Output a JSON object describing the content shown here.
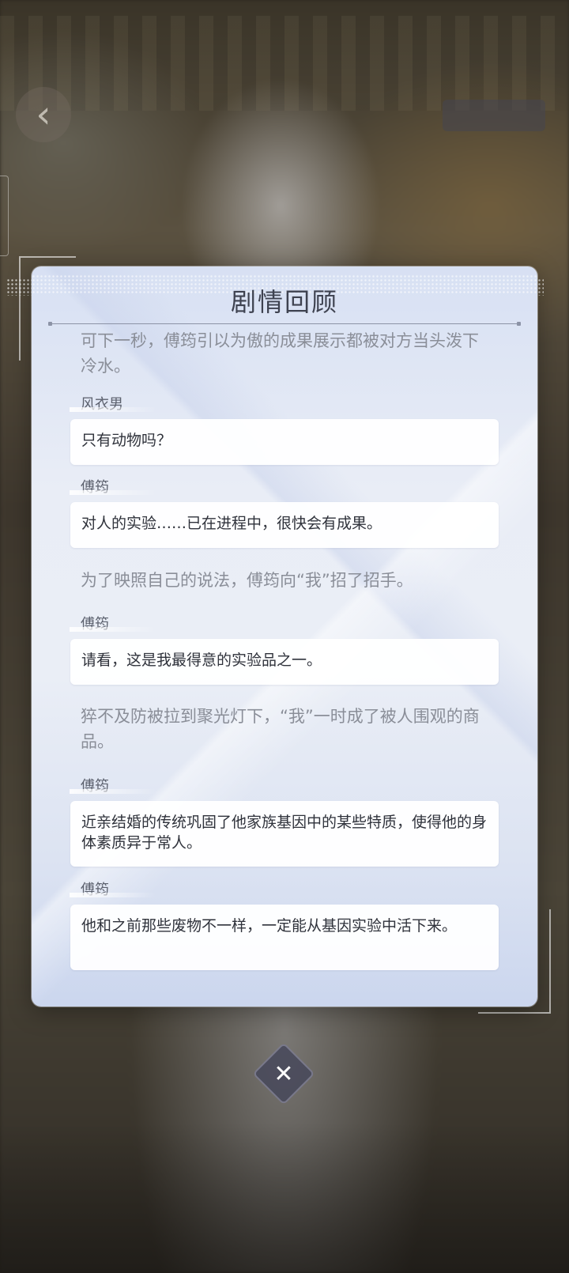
{
  "panel": {
    "title": "剧情回顾"
  },
  "entries": [
    {
      "type": "narration",
      "text": "可下一秒，傅筠引以为傲的成果展示都被对方当头泼下冷水。"
    },
    {
      "type": "dialogue",
      "speaker": "风衣男",
      "text": "只有动物吗？"
    },
    {
      "type": "dialogue",
      "speaker": "傅筠",
      "text": "对人的实验……已在进程中，很快会有成果。"
    },
    {
      "type": "narration",
      "text": "为了映照自己的说法，傅筠向“我”招了招手。"
    },
    {
      "type": "dialogue",
      "speaker": "傅筠",
      "text": "请看，这是我最得意的实验品之一。"
    },
    {
      "type": "narration",
      "text": "猝不及防被拉到聚光灯下，“我”一时成了被人围观的商品。"
    },
    {
      "type": "dialogue",
      "speaker": "傅筠",
      "text": "近亲结婚的传统巩固了他家族基因中的某些特质，使得他的身体素质异于常人。"
    },
    {
      "type": "dialogue",
      "speaker": "傅筠",
      "text": "他和之前那些废物不一样，一定能从基因实验中活下来。"
    }
  ],
  "controls": {
    "close_icon": "✕",
    "back_icon": "‹"
  }
}
